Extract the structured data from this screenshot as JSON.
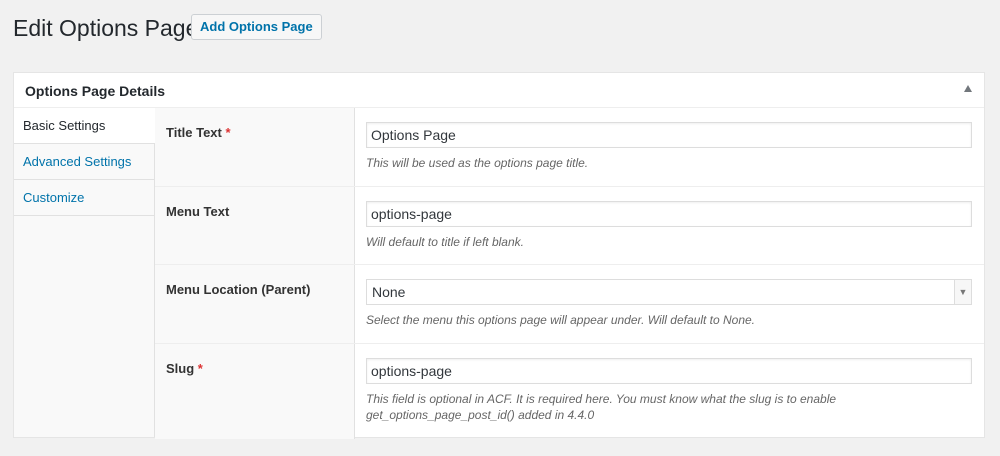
{
  "page": {
    "title": "Edit Options Page",
    "add_button_label": "Add Options Page"
  },
  "postbox": {
    "title": "Options Page Details"
  },
  "tabs": [
    {
      "label": "Basic Settings",
      "active": true
    },
    {
      "label": "Advanced Settings",
      "active": false
    },
    {
      "label": "Customize",
      "active": false
    }
  ],
  "fields": {
    "title_text": {
      "label": "Title Text",
      "required": "*",
      "value": "Options Page",
      "description": "This will be used as the options page title."
    },
    "menu_text": {
      "label": "Menu Text",
      "value": "options-page",
      "description": "Will default to title if left blank."
    },
    "menu_location": {
      "label": "Menu Location (Parent)",
      "selected": "None",
      "description": "Select the menu this options page will appear under. Will default to None."
    },
    "slug": {
      "label": "Slug",
      "required": "*",
      "value": "options-page",
      "description_line1": "This field is optional in ACF. It is required here. You must know what the slug is to enable",
      "description_line2": "get_options_page_post_id() added in 4.4.0"
    }
  },
  "colors": {
    "link": "#0073aa",
    "required": "#dc3232",
    "background": "#f1f1f1"
  },
  "icons": {
    "collapse": "triangle-up-icon",
    "select": "chevron-down-icon"
  }
}
